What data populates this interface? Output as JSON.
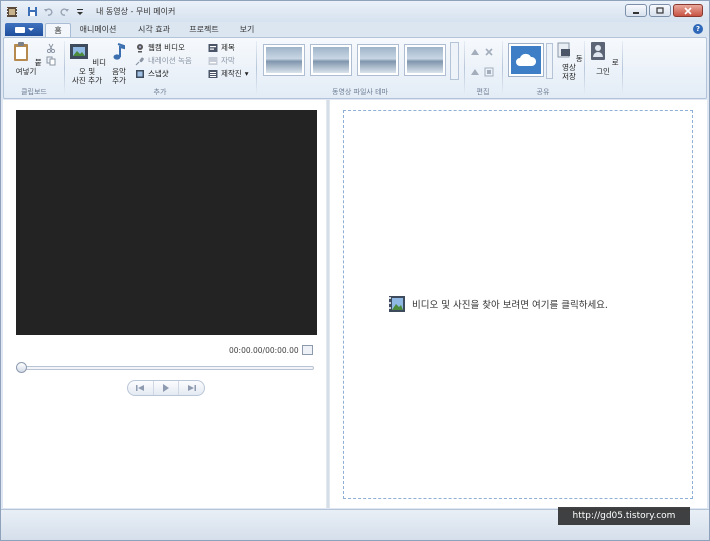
{
  "window": {
    "title": "내 동영상 - 무비 메이커"
  },
  "tabs": [
    {
      "label": "홈"
    },
    {
      "label": "애니메이션"
    },
    {
      "label": "시각 효과"
    },
    {
      "label": "프로젝트"
    },
    {
      "label": "보기"
    }
  ],
  "ribbon": {
    "clipboard": {
      "title": "클립보드",
      "paste_label": "붙여넣기"
    },
    "add": {
      "title": "추가",
      "add_media_line1": "비디오 및",
      "add_media_line2": "사진 추가",
      "music_line1": "음악",
      "music_line2": "추가",
      "webcam_label": "웹캠 비디오",
      "narration_label": "내레이션 녹음",
      "snapshot_label": "스냅샷",
      "title_label": "제목",
      "caption_label": "자막",
      "credits_label": "제작진"
    },
    "themes": {
      "title": "동영상 파일사 테마"
    },
    "edit": {
      "title": "편집"
    },
    "share": {
      "title": "공유",
      "save_line1": "동영상",
      "save_line2": "저장"
    },
    "login_label": "로그인"
  },
  "preview": {
    "timecode": "00:00.00/00:00.00"
  },
  "storyboard": {
    "message": "비디오 및 사진을 찾아 보려면 여기를 클릭하세요."
  },
  "watermark": {
    "text": "http://gd05.tistory.com"
  },
  "colors": {
    "accent": "#2f68b8",
    "preview_bg": "#232323",
    "storyboard_border": "#8fb0d6"
  }
}
